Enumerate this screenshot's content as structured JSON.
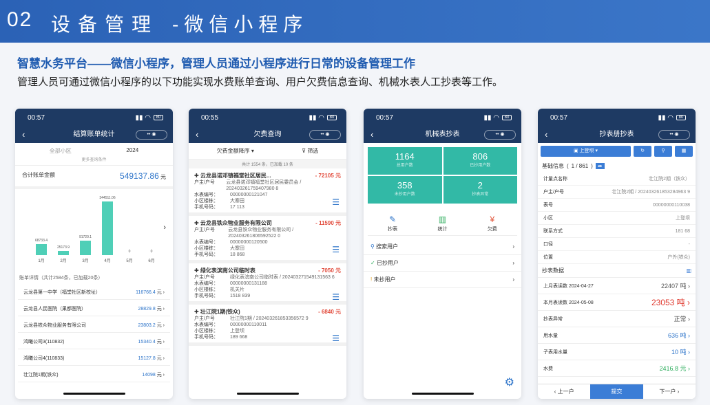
{
  "header": {
    "num": "02",
    "title": "设备管理",
    "sub": "-微信小程序"
  },
  "lead": "智慧水务平台——微信小程序，管理人员通过小程序进行日常的设备管理工作",
  "desc": "管理人员可通过微信小程序的以下功能实现水费账单查询、用户欠费信息查询、机械水表人工抄表等工作。",
  "p1": {
    "time": "00:57",
    "title": "结算账单统计",
    "area": "全部小区",
    "year": "2024",
    "more": "更多查询条件",
    "total_label": "合计账单金额",
    "total": "549137.86",
    "unit": "元",
    "chart": {
      "type": "bar",
      "categories": [
        "1月",
        "2月",
        "3月",
        "4月",
        "5月",
        "6月"
      ],
      "values": [
        68733.4,
        25173.9,
        91720.1,
        344511.06,
        0,
        0
      ],
      "labels": [
        "68733.4",
        "25173.9",
        "91720.1",
        "344511.06",
        "0",
        "0"
      ]
    },
    "detail": "账单详情（共计2584条，已加载20条）",
    "rows": [
      {
        "n": "云龙县第一中学（福堂社区新校址）",
        "v": "116766.4"
      },
      {
        "n": "云龙县人民医院（果都医院）",
        "v": "28829.8"
      },
      {
        "n": "云龙县铁众物业服务有限公司",
        "v": "23803.2"
      },
      {
        "n": "鸿曦公司3(110832)",
        "v": "15340.4"
      },
      {
        "n": "鸿曦公司4(110833)",
        "v": "15127.8"
      },
      {
        "n": "壮江院1期(铁众)",
        "v": "14098"
      }
    ]
  },
  "p2": {
    "time": "00:55",
    "title": "欠费查询",
    "sort": "欠费金额降序",
    "filter": "筛选",
    "count": "共计 1554 条，已加载 10 条",
    "cards": [
      {
        "name": "云龙县诺邓镇福堂社区居民...",
        "amt": "- 72105",
        "owner": "云龙县诺邓镇福堂社区居民委员会 / 202403261759407980 8",
        "meter": "00000000121047",
        "build": "大寨田",
        "bld2": "17 113",
        "phone": "",
        "k1": "户主/户号",
        "k2": "水表编号：",
        "k3": "小区楼栋：",
        "k4": "手机号码："
      },
      {
        "name": "云龙县铁众物业服务有限公司",
        "amt": "- 11590",
        "owner": "云龙县铁众物业服务有限公司 / 202403261806592522 0",
        "meter": "00000000120500",
        "build": "大寨田",
        "phone": "18    868",
        "k1": "户主/户号",
        "k2": "水表编号：",
        "k3": "小区楼栋：",
        "k4": "手机号码："
      },
      {
        "name": "绿化表滨南公司临时表",
        "amt": "- 7050",
        "owner": "绿化表滨南公司临时表 / 202403271549131563 6",
        "meter": "00000000131188",
        "build": "机关片",
        "phone": "1518    839",
        "k1": "户主/户号",
        "k2": "水表编号：",
        "k3": "小区楼栋：",
        "k4": "手机号码："
      },
      {
        "name": "壮江院1期(铁众)",
        "amt": "- 6840",
        "owner": "壮江院1期 / 202403261853356572 9",
        "meter": "00000000110011",
        "build": "上登坝",
        "phone": "189    668",
        "k1": "户主/户号",
        "k2": "水表编号：",
        "k3": "小区楼栋：",
        "k4": "手机号码："
      }
    ],
    "yuan": "元"
  },
  "p3": {
    "time": "00:57",
    "title": "机械表抄表",
    "stats": [
      {
        "n": "1164",
        "l": "总用户数"
      },
      {
        "n": "806",
        "l": "已抄用户数"
      },
      {
        "n": "358",
        "l": "未抄用户数"
      },
      {
        "n": "2",
        "l": "抄表异常"
      }
    ],
    "acts": [
      "抄表",
      "统计",
      "欠费"
    ],
    "menu": [
      "搜索用户",
      "已抄用户",
      "未抄用户"
    ]
  },
  "p4": {
    "time": "00:57",
    "title": "抄表册抄表",
    "book": "上登坝",
    "base": "基础信息",
    "page": "1 / 861",
    "kv": [
      {
        "k": "计量点名称",
        "v": "壮江院2期（铁众）"
      },
      {
        "k": "户主/户号",
        "v": "壮江院2期 / 202403261853284963 9"
      },
      {
        "k": "表号",
        "v": "00000000110038"
      },
      {
        "k": "小区",
        "v": "上登坝"
      },
      {
        "k": "联系方式",
        "v": "181    68"
      },
      {
        "k": "口径",
        "v": "-"
      },
      {
        "k": "位置",
        "v": "户外(铁众)"
      }
    ],
    "rdtitle": "抄表数据",
    "rd": [
      {
        "k": "上月表读数 2024-04-27",
        "v": "22407",
        "u": "吨"
      },
      {
        "k": "本月表读数 2024-05-08",
        "v": "23053",
        "u": "吨"
      },
      {
        "k": "抄表异常",
        "v": "正常",
        "u": ""
      },
      {
        "k": "用水量",
        "v": "636",
        "u": "吨"
      },
      {
        "k": "子表用水量",
        "v": "10",
        "u": "吨"
      },
      {
        "k": "水费",
        "v": "2416.8",
        "u": "元"
      }
    ],
    "prev": "上一户",
    "submit": "提交",
    "next": "下一户"
  }
}
